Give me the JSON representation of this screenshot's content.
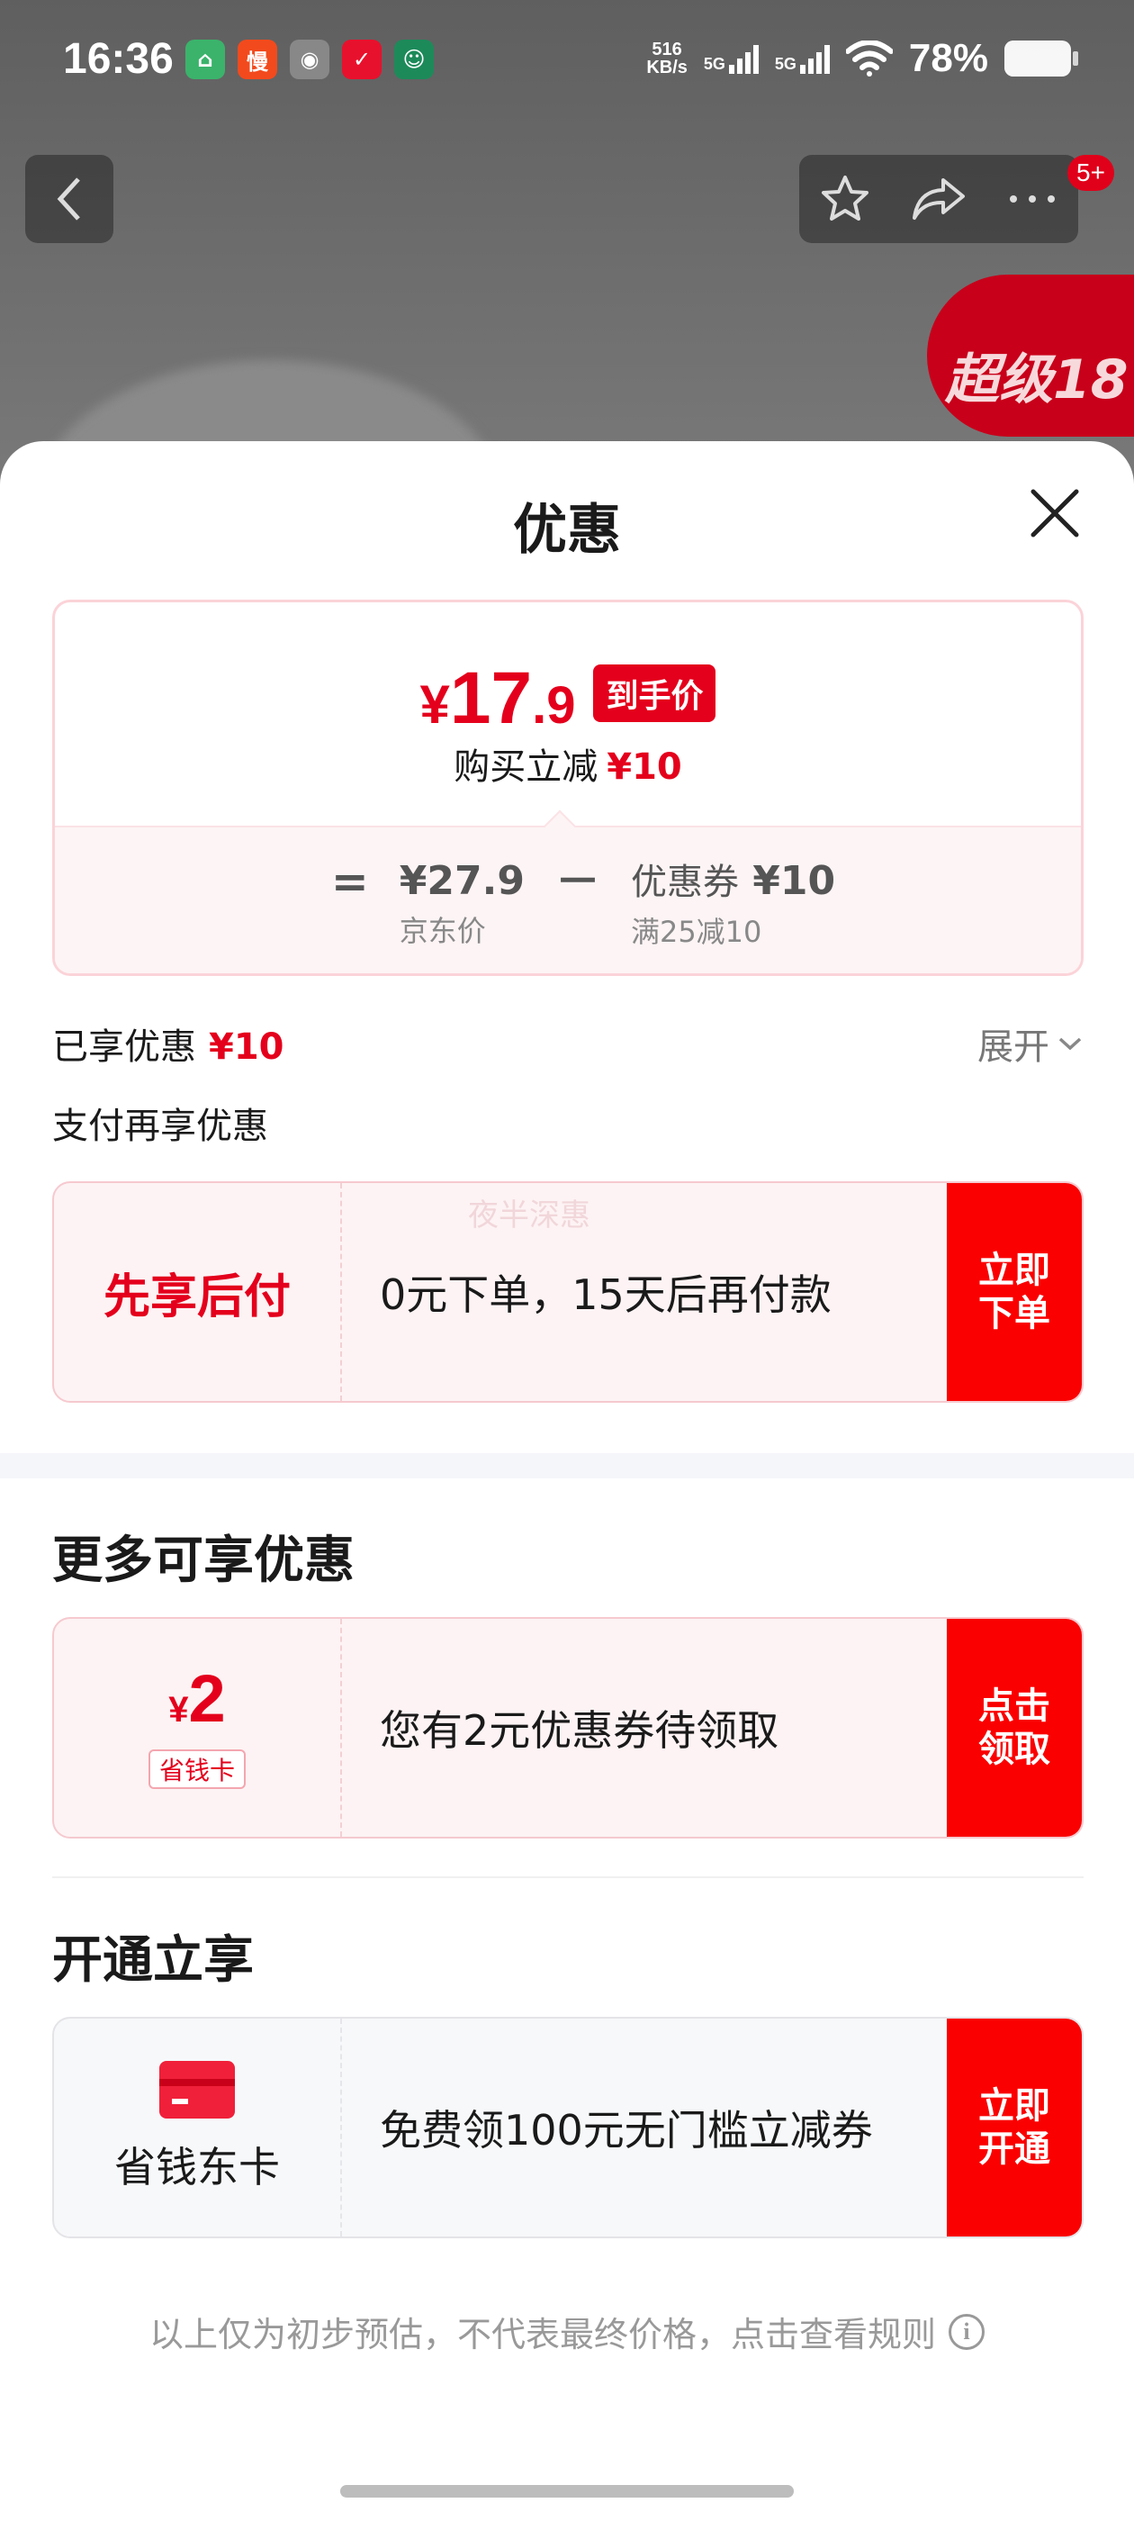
{
  "status_bar": {
    "time": "16:36",
    "app_icons": [
      {
        "name": "home-app-icon",
        "glyph": "⌂",
        "color": "#3bb36b"
      },
      {
        "name": "man-app-icon",
        "glyph": "慢",
        "color": "#f24a1d"
      },
      {
        "name": "cat-app-icon",
        "glyph": "◉",
        "color": "#888888"
      },
      {
        "name": "send-app-icon",
        "glyph": "✓",
        "color": "#e8112d"
      },
      {
        "name": "avatar-app-icon",
        "glyph": "☺",
        "color": "#1d8a5a"
      }
    ],
    "net_speed_value": "516",
    "net_speed_unit": "KB/s",
    "signal1_label": "5G",
    "signal2_label": "5G",
    "battery": "78%",
    "battery_level": 0.78
  },
  "background": {
    "badge": "5+",
    "promo_text": "超级18"
  },
  "sheet": {
    "title": "优惠",
    "price_card": {
      "currency": "¥",
      "final_int": "17",
      "final_dec": ".9",
      "final_badge": "到手价",
      "reduce_label": "购买立减",
      "reduce_amount": "¥10",
      "jd_price": "¥27.9",
      "jd_price_label": "京东价",
      "minus": "－",
      "equals": "=",
      "coupon_label": "优惠券",
      "coupon_value": "¥10",
      "coupon_condition": "满25减10"
    },
    "enjoyed_label": "已享优惠",
    "enjoyed_amount": "¥10",
    "expand_label": "展开",
    "pay_section_title": "支付再享优惠",
    "bnpl": {
      "name": "先享后付",
      "desc": "0元下单，15天后再付款",
      "watermark": "夜半深惠",
      "btn_line1": "立即",
      "btn_line2": "下单"
    },
    "more_title": "更多可享优惠",
    "coupon": {
      "currency": "¥",
      "amount": "2",
      "tag": "省钱卡",
      "desc": "您有2元优惠券待领取",
      "btn_line1": "点击",
      "btn_line2": "领取"
    },
    "open_title": "开通立享",
    "card": {
      "name": "省钱东卡",
      "desc": "免费领100元无门槛立减券",
      "btn_line1": "立即",
      "btn_line2": "开通"
    },
    "footnote": "以上仅为初步预估，不代表最终价格，点击查看规则",
    "accent_color": "#e4001c",
    "button_color": "#fa0000"
  }
}
